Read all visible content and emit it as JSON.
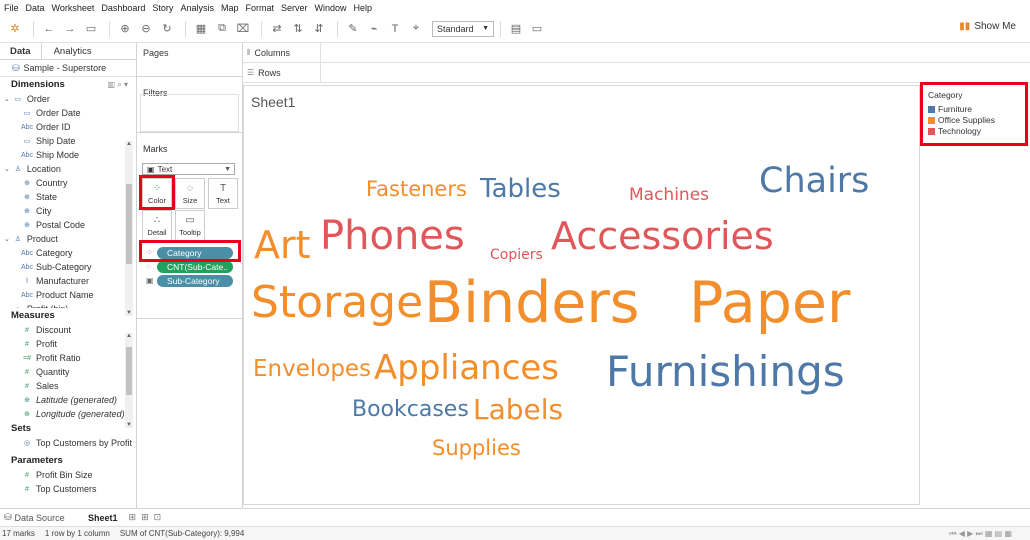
{
  "menu": [
    "File",
    "Data",
    "Worksheet",
    "Dashboard",
    "Story",
    "Analysis",
    "Map",
    "Format",
    "Server",
    "Window",
    "Help"
  ],
  "toolbar": {
    "fit_value": "Standard",
    "show_me": "Show Me"
  },
  "data_pane": {
    "tabs": [
      "Data",
      "Analytics"
    ],
    "datasource": "Sample - Superstore",
    "dimensions_label": "Dimensions",
    "dimensions": [
      {
        "icon": "folder-icon",
        "label": "Order",
        "level": 0
      },
      {
        "icon": "calendar-icon",
        "label": "Order Date",
        "level": 1
      },
      {
        "icon": "abc-icon",
        "label": "Order ID",
        "level": 1
      },
      {
        "icon": "calendar-icon",
        "label": "Ship Date",
        "level": 1
      },
      {
        "icon": "abc-icon",
        "label": "Ship Mode",
        "level": 1
      },
      {
        "icon": "hierarchy-icon",
        "label": "Location",
        "level": 0
      },
      {
        "icon": "globe-icon",
        "label": "Country",
        "level": 1
      },
      {
        "icon": "globe-icon",
        "label": "State",
        "level": 1
      },
      {
        "icon": "globe-icon",
        "label": "City",
        "level": 1
      },
      {
        "icon": "globe-icon",
        "label": "Postal Code",
        "level": 1
      },
      {
        "icon": "hierarchy-icon",
        "label": "Product",
        "level": 0
      },
      {
        "icon": "abc-icon",
        "label": "Category",
        "level": 1
      },
      {
        "icon": "abc-icon",
        "label": "Sub-Category",
        "level": 1
      },
      {
        "icon": "paperclip-icon",
        "label": "Manufacturer",
        "level": 1
      },
      {
        "icon": "abc-icon",
        "label": "Product Name",
        "level": 1
      },
      {
        "icon": "bin-icon",
        "label": "Profit (bin)",
        "level": 0
      }
    ],
    "measures_label": "Measures",
    "measures": [
      {
        "icon": "hash-icon",
        "label": "Discount",
        "italic": false
      },
      {
        "icon": "hash-icon",
        "label": "Profit",
        "italic": false
      },
      {
        "icon": "calc-icon",
        "label": "Profit Ratio",
        "italic": false
      },
      {
        "icon": "hash-icon",
        "label": "Quantity",
        "italic": false
      },
      {
        "icon": "hash-icon",
        "label": "Sales",
        "italic": false
      },
      {
        "icon": "globe-icon",
        "label": "Latitude (generated)",
        "italic": true
      },
      {
        "icon": "globe-icon",
        "label": "Longitude (generated)",
        "italic": true
      }
    ],
    "sets_label": "Sets",
    "sets": [
      {
        "icon": "set-icon",
        "label": "Top Customers by Profit"
      }
    ],
    "parameters_label": "Parameters",
    "parameters": [
      {
        "icon": "hash-icon",
        "label": "Profit Bin Size"
      },
      {
        "icon": "hash-icon",
        "label": "Top Customers"
      }
    ]
  },
  "cards": {
    "pages": "Pages",
    "filters": "Filters",
    "marks": "Marks",
    "mark_type": "Text",
    "mark_buttons": [
      "Color",
      "Size",
      "Text",
      "Detail",
      "Tooltip"
    ],
    "pills": [
      "Category",
      "CNT(Sub-Cate..",
      "Sub-Category"
    ]
  },
  "shelves": {
    "columns": "Columns",
    "rows": "Rows"
  },
  "viz": {
    "sheet_title": "Sheet1",
    "words": [
      {
        "text": "Fasteners",
        "category": "Office Supplies"
      },
      {
        "text": "Tables",
        "category": "Furniture"
      },
      {
        "text": "Machines",
        "category": "Technology"
      },
      {
        "text": "Chairs",
        "category": "Furniture"
      },
      {
        "text": "Art",
        "category": "Office Supplies"
      },
      {
        "text": "Phones",
        "category": "Technology"
      },
      {
        "text": "Copiers",
        "category": "Technology"
      },
      {
        "text": "Accessories",
        "category": "Technology"
      },
      {
        "text": "Storage",
        "category": "Office Supplies"
      },
      {
        "text": "Binders",
        "category": "Office Supplies"
      },
      {
        "text": "Paper",
        "category": "Office Supplies"
      },
      {
        "text": "Envelopes",
        "category": "Office Supplies"
      },
      {
        "text": "Appliances",
        "category": "Office Supplies"
      },
      {
        "text": "Furnishings",
        "category": "Furniture"
      },
      {
        "text": "Bookcases",
        "category": "Furniture"
      },
      {
        "text": "Labels",
        "category": "Office Supplies"
      },
      {
        "text": "Supplies",
        "category": "Office Supplies"
      }
    ]
  },
  "legend": {
    "title": "Category",
    "items": [
      {
        "label": "Furniture",
        "color": "#4e79a7"
      },
      {
        "label": "Office Supplies",
        "color": "#f28e2b"
      },
      {
        "label": "Technology",
        "color": "#e15759"
      }
    ]
  },
  "tabs": {
    "data_source": "Data Source",
    "sheet": "Sheet1"
  },
  "status": [
    "17 marks",
    "1 row by 1 column",
    "SUM of CNT(Sub-Category): 9,994"
  ],
  "colors": {
    "Furniture": "#4e79a7",
    "Office Supplies": "#f28e2b",
    "Technology": "#e15759",
    "highlight": "#e8001c"
  }
}
